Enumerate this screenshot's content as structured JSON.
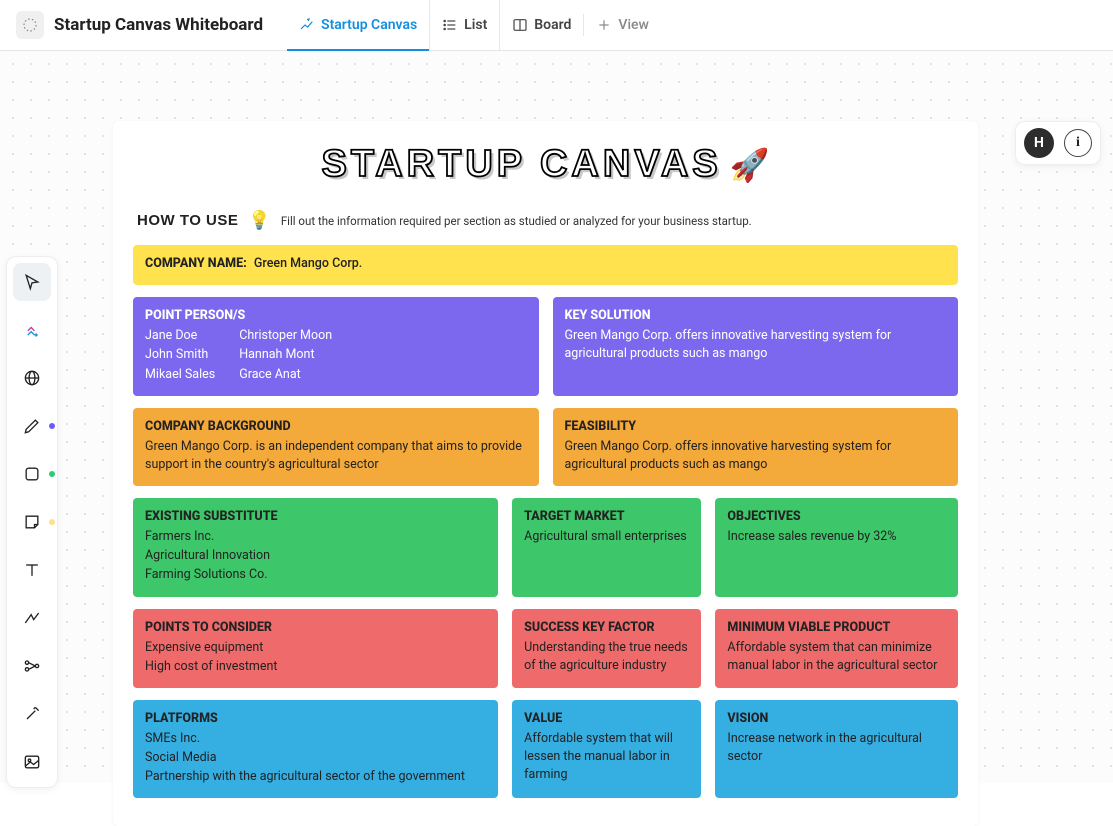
{
  "header": {
    "doc_title": "Startup Canvas Whiteboard",
    "tabs": [
      {
        "label": "Startup Canvas",
        "type": "whiteboard",
        "active": true
      },
      {
        "label": "List",
        "type": "list"
      },
      {
        "label": "Board",
        "type": "board"
      },
      {
        "label": "View",
        "type": "add"
      }
    ]
  },
  "corner": {
    "avatar_letter": "H",
    "info_glyph": "i"
  },
  "canvas": {
    "title": "STARTUP CANVAS",
    "rocket": "🚀",
    "howto_label": "HOW TO USE",
    "howto_bulb": "💡",
    "howto_text": "Fill out the information required per section as studied or analyzed for your business startup."
  },
  "sections": {
    "company_name": {
      "heading": "COMPANY NAME:",
      "value": "Green Mango Corp."
    },
    "point_persons": {
      "heading": "POINT PERSON/S",
      "col1": [
        "Jane Doe",
        "John Smith",
        "Mikael Sales"
      ],
      "col2": [
        "Christoper Moon",
        "Hannah Mont",
        "Grace Anat"
      ]
    },
    "key_solution": {
      "heading": "KEY SOLUTION",
      "body": "Green Mango Corp. offers innovative harvesting system for agricultural products such as mango"
    },
    "company_background": {
      "heading": "COMPANY BACKGROUND",
      "body": "Green Mango Corp. is an independent company that aims to provide support in the country's agricultural sector"
    },
    "feasibility": {
      "heading": "FEASIBILITY",
      "body": "Green Mango Corp. offers innovative harvesting system for agricultural products such as mango"
    },
    "existing_substitute": {
      "heading": "EXISTING SUBSTITUTE",
      "items": [
        "Farmers Inc.",
        "Agricultural Innovation",
        "Farming Solutions Co."
      ]
    },
    "target_market": {
      "heading": "TARGET MARKET",
      "body": "Agricultural small enterprises"
    },
    "objectives": {
      "heading": "OBJECTIVES",
      "body": "Increase sales revenue by 32%"
    },
    "points_to_consider": {
      "heading": "POINTS TO CONSIDER",
      "items": [
        "Expensive equipment",
        "High cost of investment"
      ]
    },
    "success_key_factor": {
      "heading": "SUCCESS KEY FACTOR",
      "body": "Understanding the true needs of the agriculture industry"
    },
    "mvp": {
      "heading": "MINIMUM VIABLE PRODUCT",
      "body": "Affordable system that can minimize manual labor in the agricultural sector"
    },
    "platforms": {
      "heading": "PLATFORMS",
      "items": [
        "SMEs Inc.",
        "Social Media",
        "Partnership with the agricultural sector of the government"
      ]
    },
    "value": {
      "heading": "VALUE",
      "body": "Affordable system that will lessen the manual labor in farming"
    },
    "vision": {
      "heading": "VISION",
      "body": "Increase network in the agricultural sector"
    }
  },
  "palette_dots": {
    "pen": "#6a5bff",
    "shape": "#2ecc71",
    "sticky": "#ffe08a"
  }
}
